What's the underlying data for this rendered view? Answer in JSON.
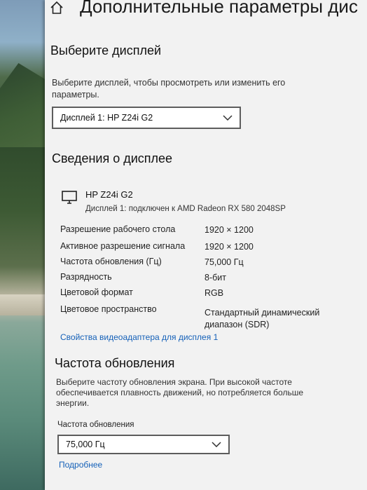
{
  "window": {
    "title": "Дополнительные параметры дис"
  },
  "select_display": {
    "heading": "Выберите дисплей",
    "description": "Выберите дисплей, чтобы просмотреть или изменить его параметры.",
    "dropdown_value": "Дисплей 1: HP Z24i G2"
  },
  "display_info": {
    "heading": "Сведения о дисплее",
    "monitor_name": "HP Z24i G2",
    "monitor_connection": "Дисплей 1: подключен к AMD Radeon RX 580 2048SP",
    "rows": [
      {
        "label": "Разрешение рабочего стола",
        "value": "1920 × 1200"
      },
      {
        "label": "Активное разрешение сигнала",
        "value": "1920 × 1200"
      },
      {
        "label": "Частота обновления (Гц)",
        "value": "75,000 Гц"
      },
      {
        "label": "Разрядность",
        "value": "8-бит"
      },
      {
        "label": "Цветовой формат",
        "value": "RGB"
      },
      {
        "label": "Цветовое пространство",
        "value": "Стандартный динамический диапазон (SDR)"
      }
    ],
    "adapter_link": "Свойства видеоадаптера для дисплея 1"
  },
  "refresh_rate": {
    "heading": "Частота обновления",
    "description": "Выберите частоту обновления экрана. При высокой частоте обеспечивается плавность движений, но потребляется больше энергии.",
    "field_label": "Частота обновления",
    "dropdown_value": "75,000 Гц",
    "more_link": "Подробнее"
  },
  "icons": {
    "home": "home-icon",
    "monitor": "monitor-icon",
    "chevron": "chevron-down-icon"
  }
}
